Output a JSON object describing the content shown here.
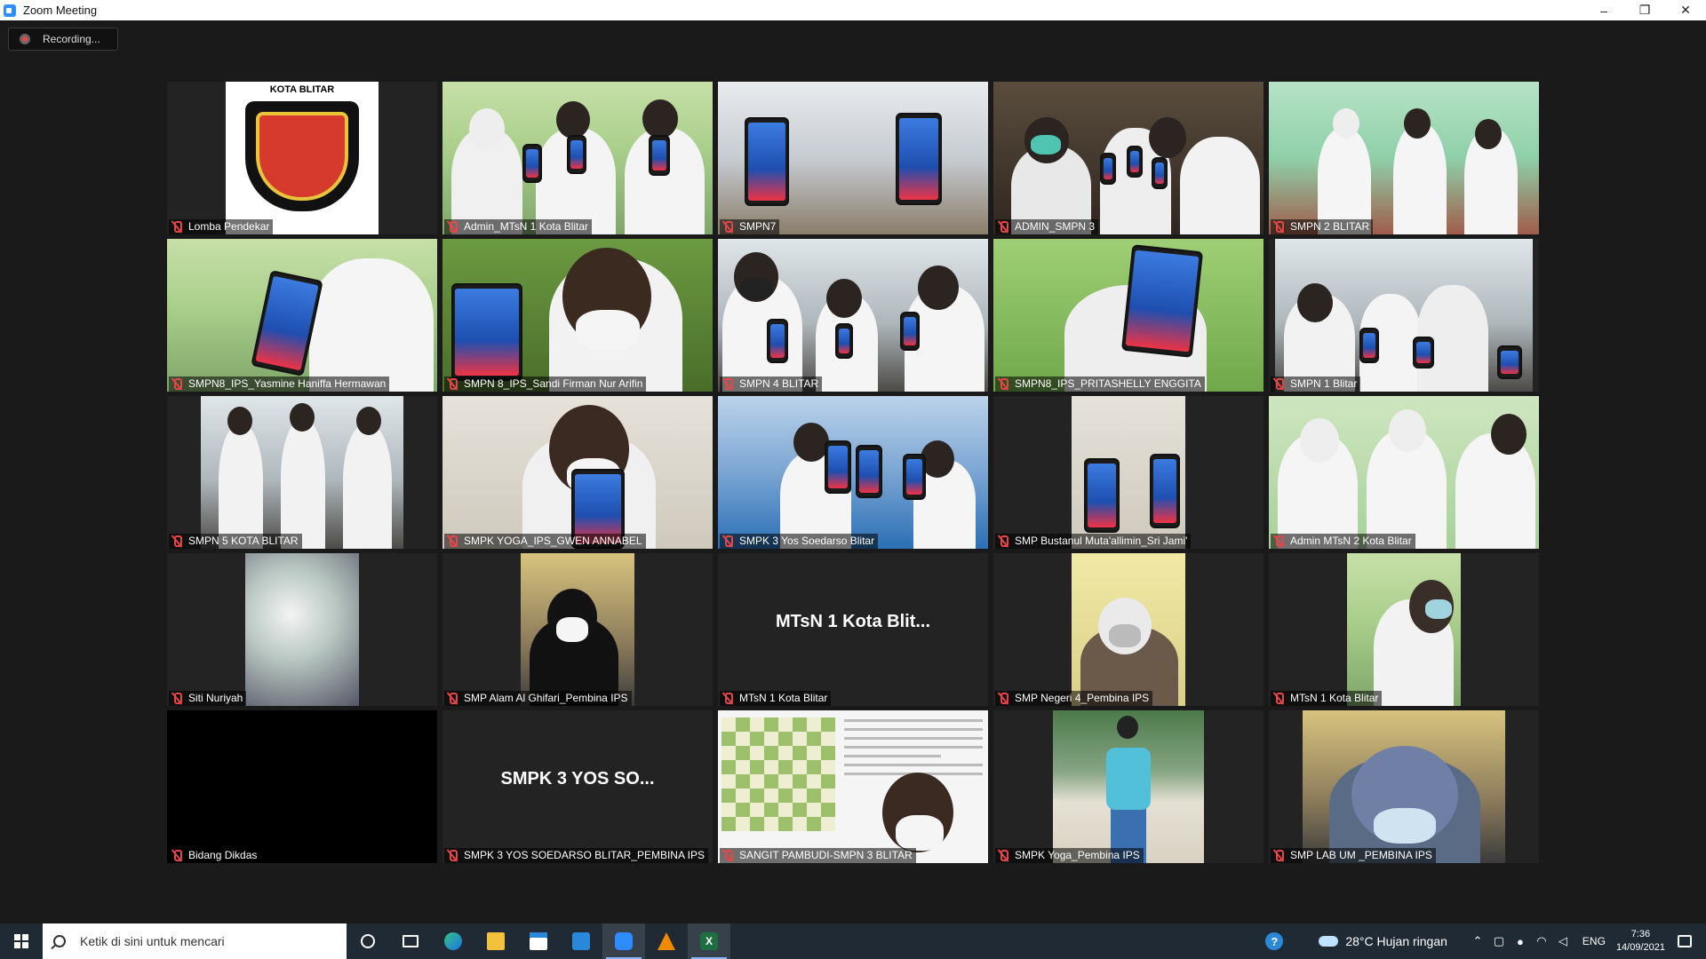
{
  "window": {
    "title": "Zoom Meeting",
    "minimize": "–",
    "restore": "❐",
    "close": "✕"
  },
  "recording": {
    "label": "Recording..."
  },
  "participants": [
    {
      "name": "Lomba Pendekar"
    },
    {
      "name": "Admin_MTsN 1 Kota Blitar"
    },
    {
      "name": "SMPN7"
    },
    {
      "name": "ADMIN_SMPN 3"
    },
    {
      "name": "SMPN 2 BLITAR"
    },
    {
      "name": "SMPN8_IPS_Yasmine Haniffa Hermawan"
    },
    {
      "name": "SMPN 8_IPS_Sandi Firman Nur Arifin"
    },
    {
      "name": "SMPN 4 BLITAR"
    },
    {
      "name": "SMPN8_IPS_PRITASHELLY ENGGITA"
    },
    {
      "name": "SMPN 1 Blitar"
    },
    {
      "name": "SMPN 5 KOTA BLITAR"
    },
    {
      "name": "SMPK YOGA_IPS_GWEN ANNABEL"
    },
    {
      "name": "SMPK 3 Yos Soedarso Blitar"
    },
    {
      "name": "SMP Bustanul Muta'allimin_Sri Jami'"
    },
    {
      "name": "Admin MTsN 2 Kota Blitar"
    },
    {
      "name": "Siti Nuriyah"
    },
    {
      "name": "SMP Alam Al Ghifari_Pembina IPS"
    },
    {
      "name": "MTsN 1 Kota Blitar",
      "center_label": "MTsN 1 Kota Blit..."
    },
    {
      "name": "SMP Negeri 4_Pembina IPS"
    },
    {
      "name": "MTsN 1 Kota Blitar"
    },
    {
      "name": "Bidang Dikdas"
    },
    {
      "name": "SMPK 3 YOS SOEDARSO BLITAR_PEMBINA IPS",
      "center_label": "SMPK 3 YOS SO..."
    },
    {
      "name": "SANGIT PAMBUDI-SMPN 3 BLITAR"
    },
    {
      "name": "SMPK Yoga_Pembina IPS"
    },
    {
      "name": "SMP LAB UM _PEMBINA IPS"
    }
  ],
  "logo": {
    "text": "KOTA BLITAR"
  },
  "taskbar": {
    "search_placeholder": "Ketik di sini untuk mencari",
    "excel_letter": "X",
    "help": "?",
    "weather": "28°C  Hujan ringan",
    "tray_chevron": "⌃",
    "lang": "ENG",
    "time": "7:36",
    "date": "14/09/2021"
  },
  "icons": [
    "zoom-app-icon",
    "record-dot-icon",
    "mic-muted-icon",
    "windows-start-icon",
    "search-icon",
    "cortana-icon",
    "task-view-icon",
    "edge-icon",
    "file-explorer-icon",
    "store-icon",
    "mail-icon",
    "zoom-icon",
    "vlc-icon",
    "excel-icon",
    "help-icon",
    "weather-icon",
    "notification-icon"
  ]
}
